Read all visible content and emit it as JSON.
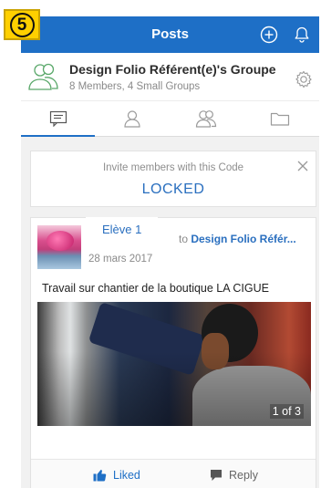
{
  "step_badge": "5",
  "topbar": {
    "title": "Posts",
    "add_icon": "plus-circle-icon",
    "bell_icon": "bell-icon"
  },
  "group": {
    "name": "Design Folio Référent(e)'s Groupe",
    "meta": "8 Members, 4 Small Groups"
  },
  "tabs": [
    {
      "icon": "message-icon",
      "active": true
    },
    {
      "icon": "person-icon",
      "active": false
    },
    {
      "icon": "people-icon",
      "active": false
    },
    {
      "icon": "folder-icon",
      "active": false
    }
  ],
  "invite": {
    "label": "Invite members with this Code",
    "code": "LOCKED"
  },
  "post": {
    "author": "Elève 1",
    "to_prefix": "to ",
    "to_group": "Design Folio Référ...",
    "date": "28 mars 2017",
    "text": "Travail sur chantier de la boutique LA CIGUE",
    "photo_counter": "1 of 3",
    "like_label": "Liked",
    "reply_label": "Reply"
  },
  "colors": {
    "brand_blue": "#1e6fc6",
    "link_blue": "#2a6fbf",
    "badge_yellow": "#ffd000"
  }
}
